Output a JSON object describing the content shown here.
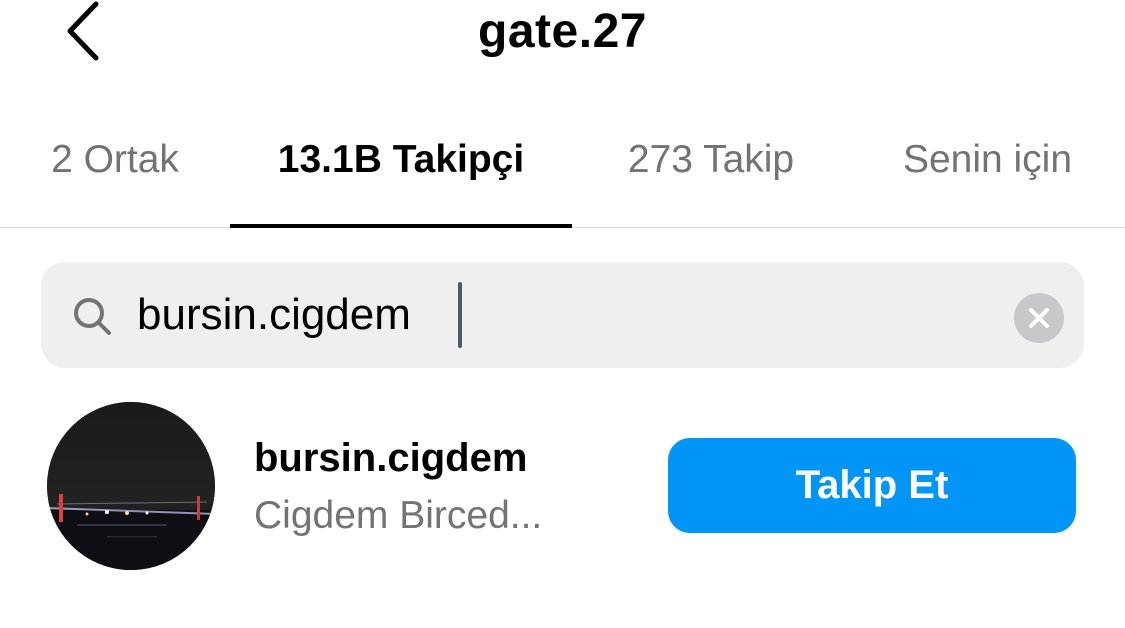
{
  "header": {
    "title": "gate.27",
    "back_icon": "chevron-left-icon"
  },
  "tabs": [
    {
      "label": "2 Ortak",
      "active": false
    },
    {
      "label": "13.1B Takipçi",
      "active": true
    },
    {
      "label": "273 Takip",
      "active": false
    },
    {
      "label": "Senin için",
      "active": false
    }
  ],
  "search": {
    "value": "bursin.cigdem",
    "icon": "search-icon",
    "clear_icon": "clear-icon"
  },
  "results": [
    {
      "username": "bursin.cigdem",
      "full_name": "Cigdem Birced...",
      "follow_label": "Takip Et"
    }
  ],
  "colors": {
    "accent": "#0095f6",
    "secondary_text": "#737373",
    "search_bg": "#efeff0",
    "divider": "#dbdbdb"
  }
}
